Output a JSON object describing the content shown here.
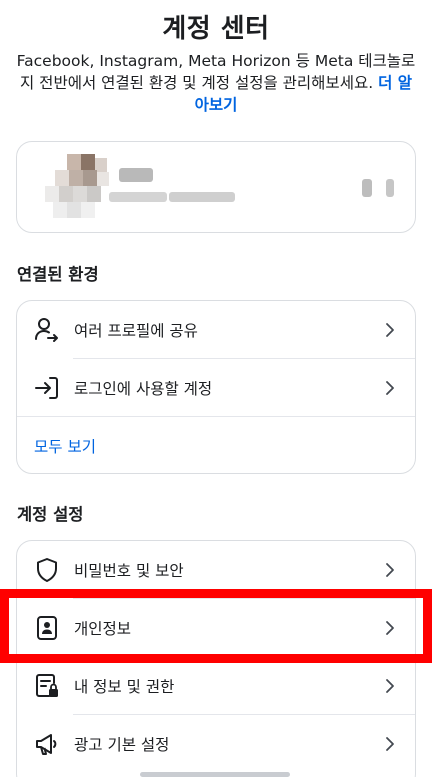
{
  "page": {
    "title": "계정 센터",
    "description": "Facebook, Instagram, Meta Horizon 등 Meta 테크놀로지 전반에서 연결된 환경 및 계정 설정을 관리해보세요.",
    "learn_more": "더 알아보기"
  },
  "connected": {
    "heading": "연결된 환경",
    "items": [
      {
        "label": "여러 프로필에 공유",
        "icon": "profile-share-icon"
      },
      {
        "label": "로그인에 사용할 계정",
        "icon": "login-arrow-icon"
      }
    ],
    "see_all": "모두 보기"
  },
  "settings": {
    "heading": "계정 설정",
    "items": [
      {
        "label": "비밀번호 및 보안",
        "icon": "shield-icon"
      },
      {
        "label": "개인정보",
        "icon": "id-card-icon"
      },
      {
        "label": "내 정보 및 권한",
        "icon": "info-permissions-icon"
      },
      {
        "label": "광고 기본 설정",
        "icon": "megaphone-icon"
      }
    ]
  },
  "colors": {
    "link": "#0064e0",
    "highlight": "#ff0000",
    "border": "#dadde1"
  }
}
